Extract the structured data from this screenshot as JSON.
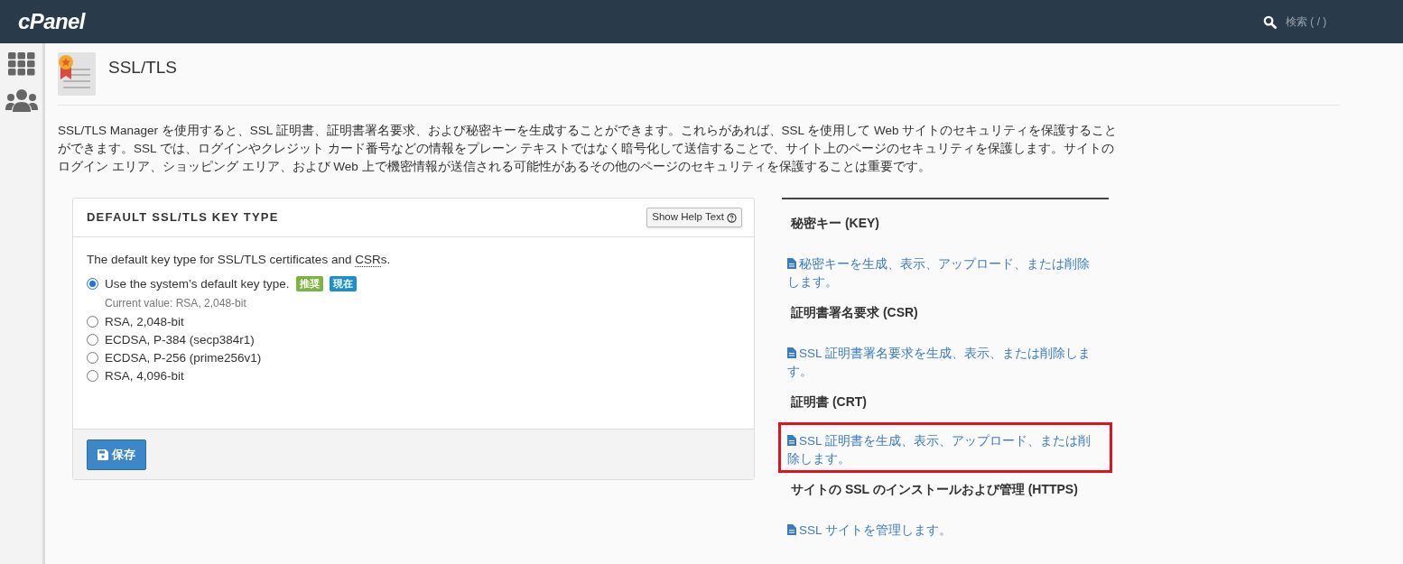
{
  "header": {
    "logo": "cPanel",
    "search": {
      "placeholder": "検索 ( / )"
    }
  },
  "page": {
    "title": "SSL/TLS",
    "description": "SSL/TLS Manager を使用すると、SSL 証明書、証明書署名要求、および秘密キーを生成することができます。これらがあれば、SSL を使用して Web サイトのセキュリティを保護することができます。SSL では、ログインやクレジット カード番号などの情報をプレーン テキストではなく暗号化して送信することで、サイト上のページのセキュリティを保護します。サイトのログイン エリア、ショッピング エリア、および Web 上で機密情報が送信される可能性があるその他のページのセキュリティを保護することは重要です。"
  },
  "panel": {
    "title": "DEFAULT SSL/TLS KEY TYPE",
    "help_button": "Show Help Text",
    "intro": {
      "before": "The default key type for SSL/TLS certificates and ",
      "abbr": "CSR",
      "after": "s."
    },
    "options": [
      {
        "label": "Use the system’s default key type.",
        "selected": true,
        "badges": [
          {
            "label": "推奨",
            "color": "#7cb342"
          },
          {
            "label": "現在",
            "color": "#1e90c8"
          }
        ],
        "note": "Current value: RSA, 2,048-bit"
      },
      {
        "label": "RSA, 2,048-bit",
        "selected": false
      },
      {
        "label": "ECDSA, P-384 (secp384r1)",
        "selected": false
      },
      {
        "label": "ECDSA, P-256 (prime256v1)",
        "selected": false
      },
      {
        "label": "RSA, 4,096-bit",
        "selected": false
      }
    ],
    "save_button": "保存"
  },
  "sections": [
    {
      "heading": "秘密キー (KEY)",
      "link": "秘密キーを生成、表示、アップロード、または削除します。",
      "highlighted": false
    },
    {
      "heading": "証明書署名要求 (CSR)",
      "link": "SSL 証明書署名要求を生成、表示、または削除します。",
      "highlighted": false
    },
    {
      "heading": "証明書 (CRT)",
      "link": "SSL 証明書を生成、表示、アップロード、または削除します。",
      "highlighted": true
    },
    {
      "heading": "サイトの SSL のインストールおよび管理 (HTTPS)",
      "link": "SSL サイトを管理します。",
      "highlighted": false
    }
  ]
}
